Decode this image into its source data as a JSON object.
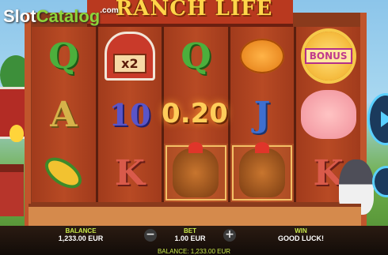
{
  "logo": {
    "prefix": "Slot",
    "accent": "Catalog",
    "suffix": ".com"
  },
  "game": {
    "title": "RANCH LIFE"
  },
  "reels": [
    [
      {
        "type": "letter",
        "char": "Q",
        "cls": "q"
      },
      {
        "type": "letter",
        "char": "A",
        "cls": "a"
      },
      {
        "type": "corn"
      }
    ],
    [
      {
        "type": "barn",
        "multiplier": "x2"
      },
      {
        "type": "letter",
        "char": "10",
        "cls": "ten"
      },
      {
        "type": "letter",
        "char": "K",
        "cls": "k"
      }
    ],
    [
      {
        "type": "letter",
        "char": "Q",
        "cls": "q"
      },
      {
        "type": "empty"
      },
      {
        "type": "hen",
        "highlight": true
      }
    ],
    [
      {
        "type": "pumpkin"
      },
      {
        "type": "letter",
        "char": "J",
        "cls": "j"
      },
      {
        "type": "hen",
        "highlight": true
      }
    ],
    [
      {
        "type": "sun",
        "label": "BONUS"
      },
      {
        "type": "pig"
      },
      {
        "type": "letter",
        "char": "K",
        "cls": "k"
      }
    ]
  ],
  "win_amount": "0.20",
  "bar": {
    "balance_label": "BALANCE",
    "balance_value": "1,233.00 EUR",
    "bet_label": "BET",
    "bet_value": "1.00 EUR",
    "minus_label": "−",
    "plus_label": "+",
    "win_label": "WIN",
    "win_value": "GOOD LUCK!",
    "bottom_balance": "BALANCE: 1,233.00 EUR"
  }
}
